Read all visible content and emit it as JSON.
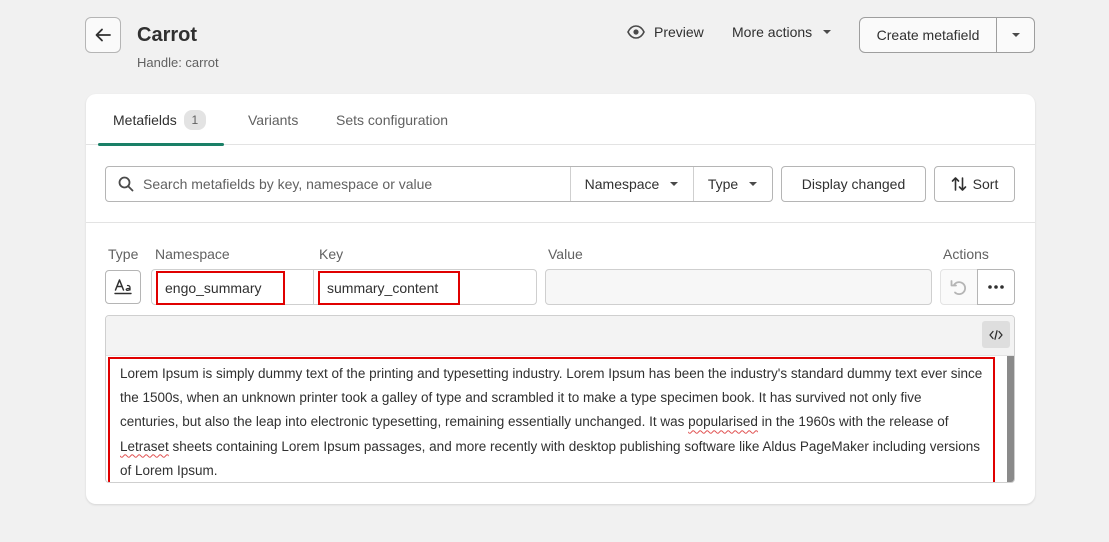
{
  "header": {
    "title": "Carrot",
    "subtitle": "Handle: carrot",
    "preview_label": "Preview",
    "more_actions_label": "More actions",
    "create_label": "Create metafield"
  },
  "tabs": [
    {
      "label": "Metafields",
      "count": "1",
      "active": true
    },
    {
      "label": "Variants"
    },
    {
      "label": "Sets configuration"
    }
  ],
  "filters": {
    "search_placeholder": "Search metafields by key, namespace or value",
    "namespace_label": "Namespace",
    "type_label": "Type",
    "display_changed_label": "Display changed",
    "sort_label": "Sort"
  },
  "table": {
    "columns": {
      "type": "Type",
      "namespace": "Namespace",
      "key": "Key",
      "value": "Value",
      "actions": "Actions"
    },
    "row": {
      "type_icon": "text-type-icon",
      "namespace": "engo_summary",
      "key": "summary_content",
      "value": "",
      "editor_text": {
        "part1": "Lorem Ipsum is simply dummy text of the printing and typesetting industry. Lorem Ipsum has been the industry's standard dummy text ever since the 1500s, when an unknown printer took a galley of type and scrambled it to make a type specimen book. It has survived not only five centuries, but also the leap into electronic typesetting, remaining essentially unchanged. It was ",
        "word1": "popularised",
        "part2": " in the 1960s with the release of ",
        "word2": "Letraset",
        "part3": " sheets containing Lorem Ipsum passages, and more recently with desktop publishing software like Aldus PageMaker including versions of Lorem Ipsum."
      }
    }
  },
  "colors": {
    "accent_tab_underline": "#1a8067",
    "highlight_box": "#e00000",
    "background": "#f1f1f1",
    "card": "#ffffff"
  },
  "icons": [
    "arrow-left-icon",
    "eye-icon",
    "chevron-down-icon",
    "search-icon",
    "sort-icon",
    "text-type-icon",
    "undo-icon",
    "ellipsis-icon",
    "code-icon"
  ]
}
